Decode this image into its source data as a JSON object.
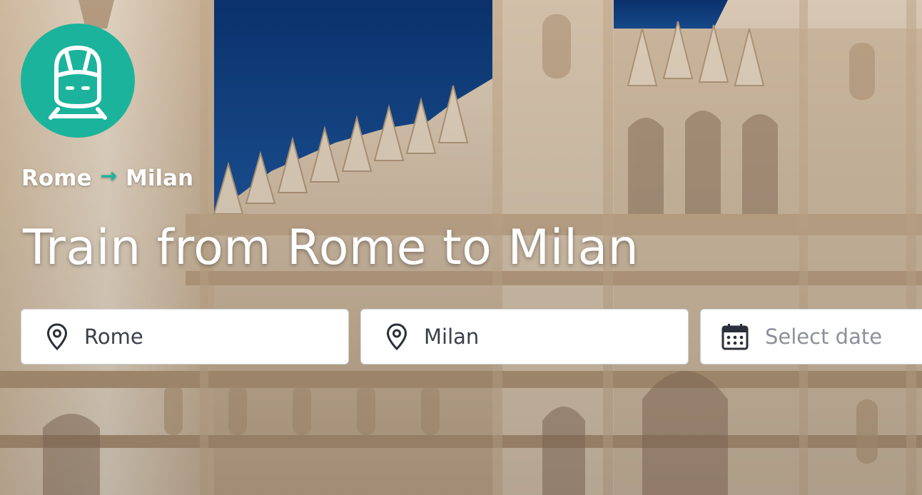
{
  "logo": {
    "icon": "train-icon",
    "color": "#1bb39b"
  },
  "breadcrumb": {
    "from": "Rome",
    "arrow": "→",
    "to": "Milan"
  },
  "title": "Train from Rome to Milan",
  "search": {
    "origin": {
      "value": "Rome",
      "icon": "map-pin-icon"
    },
    "destination": {
      "value": "Milan",
      "icon": "map-pin-icon"
    },
    "date": {
      "placeholder": "Select date",
      "icon": "calendar-icon"
    }
  },
  "colors": {
    "accent": "#1bb39b",
    "sky": "#0f3f7f",
    "field_text": "#3a3f4b"
  }
}
